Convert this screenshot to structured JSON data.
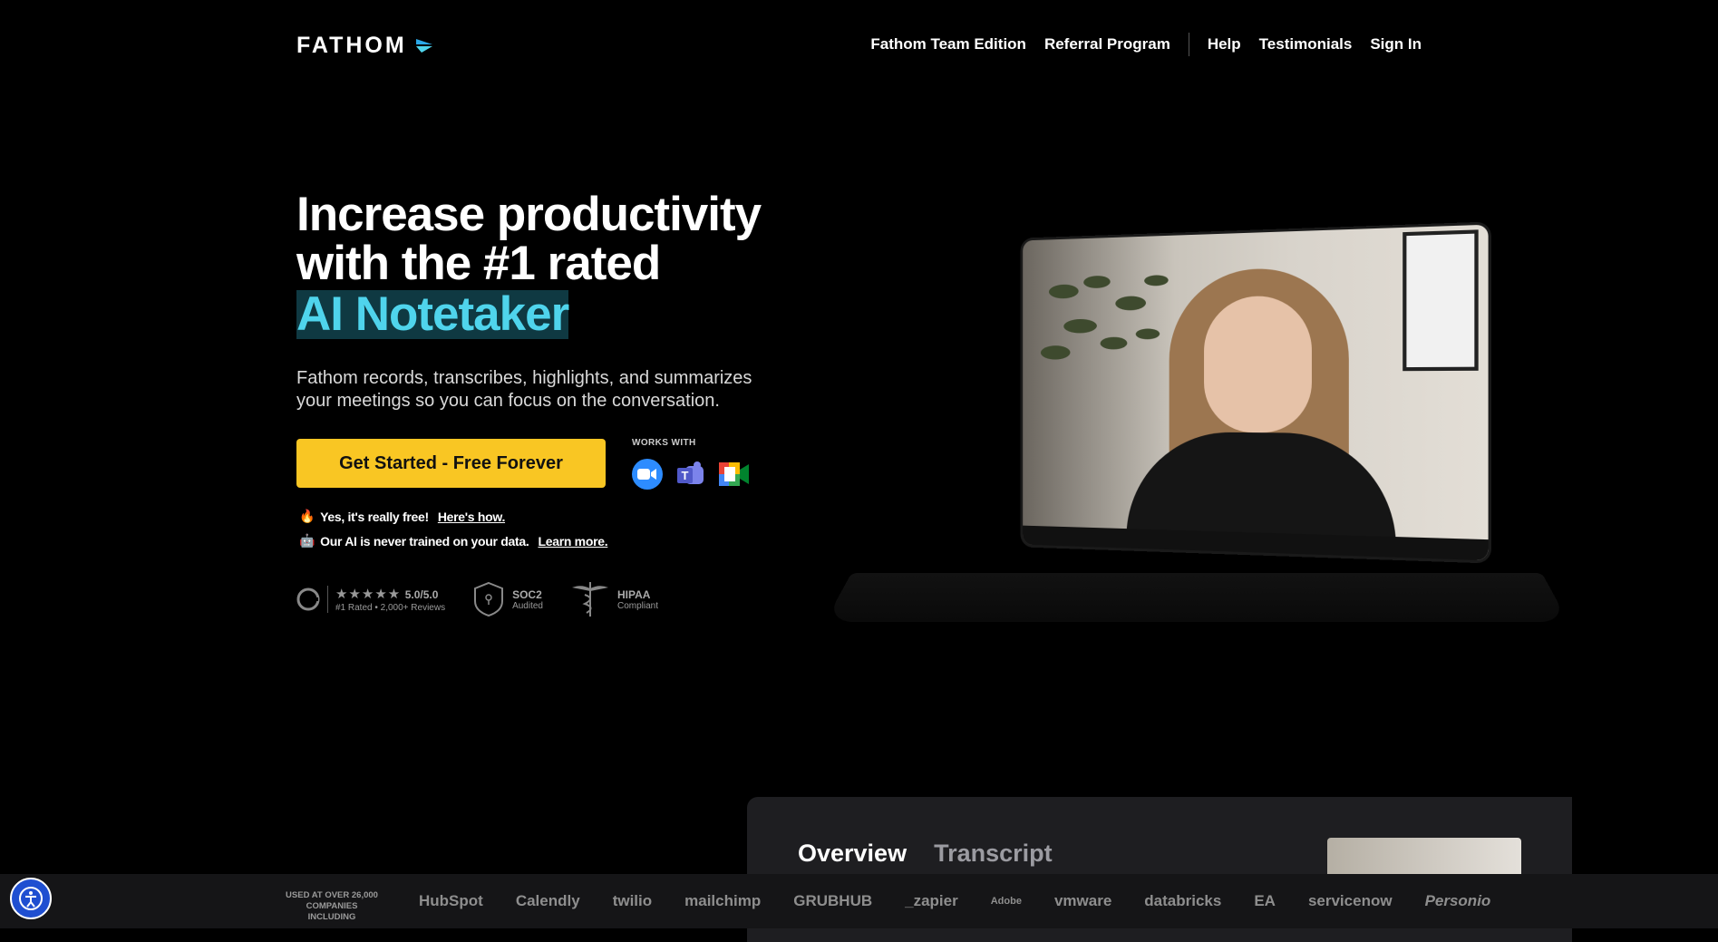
{
  "brand": {
    "name": "FATHOM"
  },
  "nav": {
    "items": [
      "Fathom Team Edition",
      "Referral Program",
      "Help",
      "Testimonials",
      "Sign In"
    ]
  },
  "hero": {
    "title_line1": "Increase productivity",
    "title_line2": "with the #1 rated",
    "title_highlight": "AI Notetaker",
    "subtitle": "Fathom records, transcribes, highlights, and summarizes your meetings so you can focus on the conversation.",
    "cta": "Get Started - Free Forever",
    "works_with": "WORKS WITH",
    "apps": [
      "zoom-icon",
      "teams-icon",
      "google-meet-icon"
    ],
    "note1": "Yes, it's really free!",
    "note1_link": "Here's how.",
    "note2": "Our AI is never trained on your data.",
    "note2_link": "Learn more."
  },
  "badges": {
    "rating": "5.0/5.0",
    "rating_sub": "#1 Rated • 2,000+ Reviews",
    "soc2": "SOC2",
    "soc2_sub": "Audited",
    "hipaa": "HIPAA",
    "hipaa_sub": "Compliant"
  },
  "card": {
    "tabs": [
      "Overview",
      "Transcript"
    ]
  },
  "strip": {
    "label_line1": "USED AT OVER 26,000",
    "label_line2": "COMPANIES INCLUDING",
    "logos": [
      "HubSpot",
      "Calendly",
      "twilio",
      "mailchimp",
      "GRUBHUB",
      "_zapier",
      "Adobe",
      "vmware",
      "databricks",
      "EA",
      "servicenow",
      "Personio"
    ]
  },
  "colors": {
    "accent": "#4fd4ec",
    "cta": "#f9c623",
    "a11y": "#1f4fd1"
  }
}
